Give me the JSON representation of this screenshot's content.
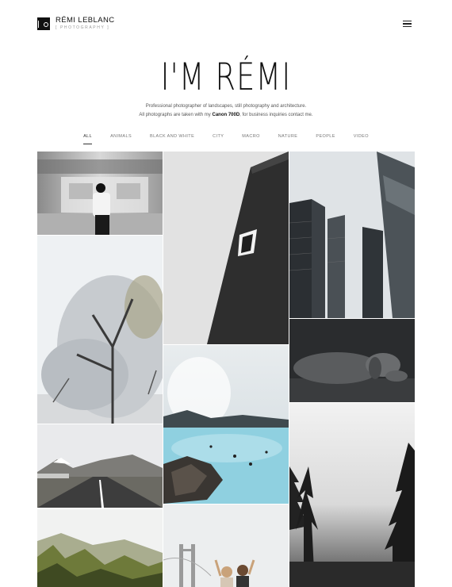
{
  "brand": {
    "name": "RÉMI LEBLANC",
    "tagline": "[ PHOTOGRAPHY ]"
  },
  "hero": {
    "title": "I'M RÉMI",
    "line1": "Professional photographer of landscapes, still photography and architecture.",
    "line2_pre": "All photographs are taken with my ",
    "line2_bold": "Canon 700D",
    "line2_post": ", for business inquiries contact me."
  },
  "filters": [
    "ALL",
    "ANIMALS",
    "BLACK AND WHITE",
    "CITY",
    "MACRO",
    "NATURE",
    "PEOPLE",
    "VIDEO"
  ],
  "active_filter": "ALL",
  "icons": {
    "logo": "camera-logo-icon",
    "menu": "hamburger-menu-icon"
  },
  "gallery": [
    {
      "name": "photo-subway-woman",
      "subject": "woman on subway platform"
    },
    {
      "name": "photo-black-tower",
      "subject": "black building facade"
    },
    {
      "name": "photo-skyscrapers",
      "subject": "skyscrapers from below"
    },
    {
      "name": "photo-snowy-tree",
      "subject": "frosted tree"
    },
    {
      "name": "photo-blue-lagoon",
      "subject": "geothermal lagoon"
    },
    {
      "name": "photo-sleeping-dog",
      "subject": "dog lying down"
    },
    {
      "name": "photo-mountain-road",
      "subject": "road through mountains"
    },
    {
      "name": "photo-foggy-forest",
      "subject": "pine trees in fog"
    },
    {
      "name": "photo-autumn-hills",
      "subject": "trees in mist"
    },
    {
      "name": "photo-bridge-people",
      "subject": "people at bridge"
    }
  ]
}
